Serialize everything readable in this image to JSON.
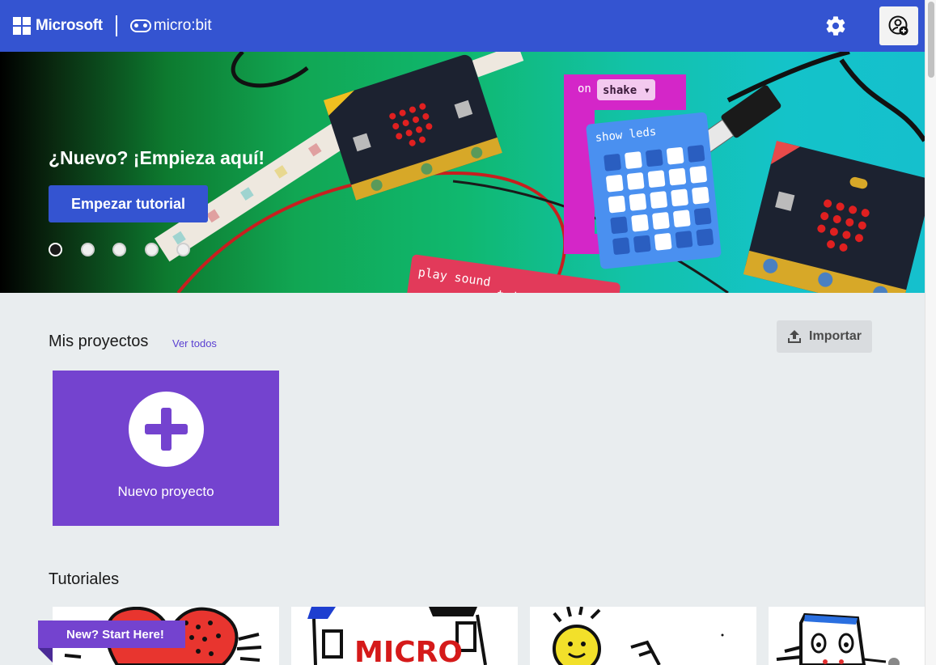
{
  "header": {
    "brand": "Microsoft",
    "product": "micro:bit",
    "icons": [
      "windows-logo-icon",
      "microbit-logo-icon",
      "gear-icon",
      "user-add-icon"
    ]
  },
  "hero": {
    "title": "¿Nuevo? ¡Empieza aquí!",
    "button_label": "Empezar tutorial",
    "carousel_count": 5,
    "carousel_active_index": 0,
    "block_texts": [
      "on",
      "shake",
      "show leds",
      "play sound",
      "twinkle"
    ]
  },
  "projects": {
    "title": "Mis proyectos",
    "see_all": "Ver todos",
    "import_label": "Importar",
    "new_project_label": "Nuevo proyecto"
  },
  "tutorials": {
    "title": "Tutoriales",
    "banner": "New? Start Here!",
    "card_art_text": "MICRO"
  },
  "colors": {
    "header_bg": "#3454d1",
    "accent_purple": "#7443cf",
    "page_bg": "#e9edef"
  }
}
